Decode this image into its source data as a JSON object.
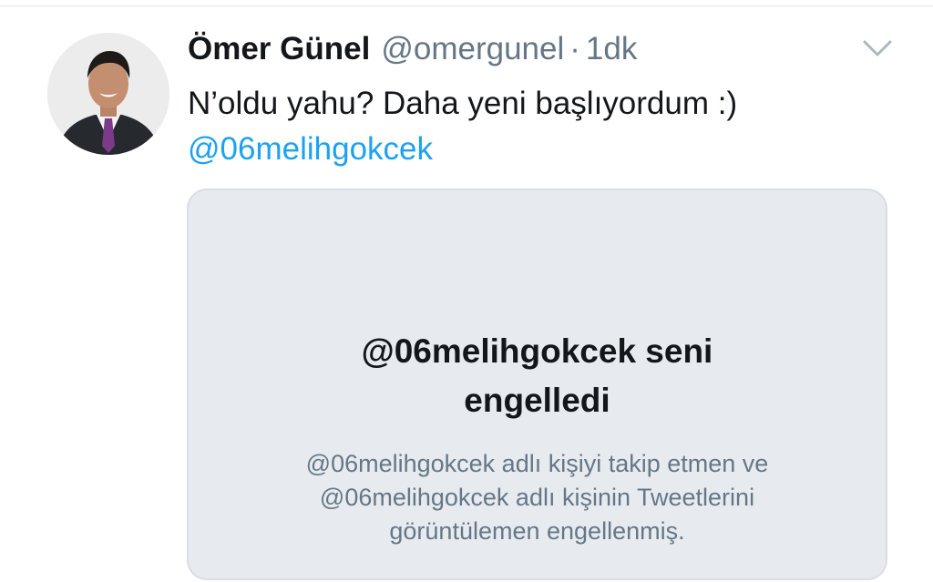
{
  "tweet": {
    "author_name": "Ömer Günel",
    "author_handle": "@omergunel",
    "separator": "·",
    "time": "1dk",
    "text": "N’oldu yahu? Daha yeni başlıyordum :)",
    "mention": "@06melihgokcek"
  },
  "blocked_card": {
    "title_line1": "@06melihgokcek seni",
    "title_line2": "engelledi",
    "body_line1": "@06melihgokcek adlı kişiyi takip etmen ve",
    "body_line2": "@06melihgokcek adlı kişinin Tweetlerini",
    "body_line3": "görüntülemen engellenmiş."
  },
  "icons": {
    "menu": "chevron-down-icon",
    "avatar": "profile-photo"
  },
  "colors": {
    "link": "#1da1f2",
    "secondary_text": "#657786",
    "primary_text": "#14171a",
    "card_background": "#e7ebf0"
  }
}
